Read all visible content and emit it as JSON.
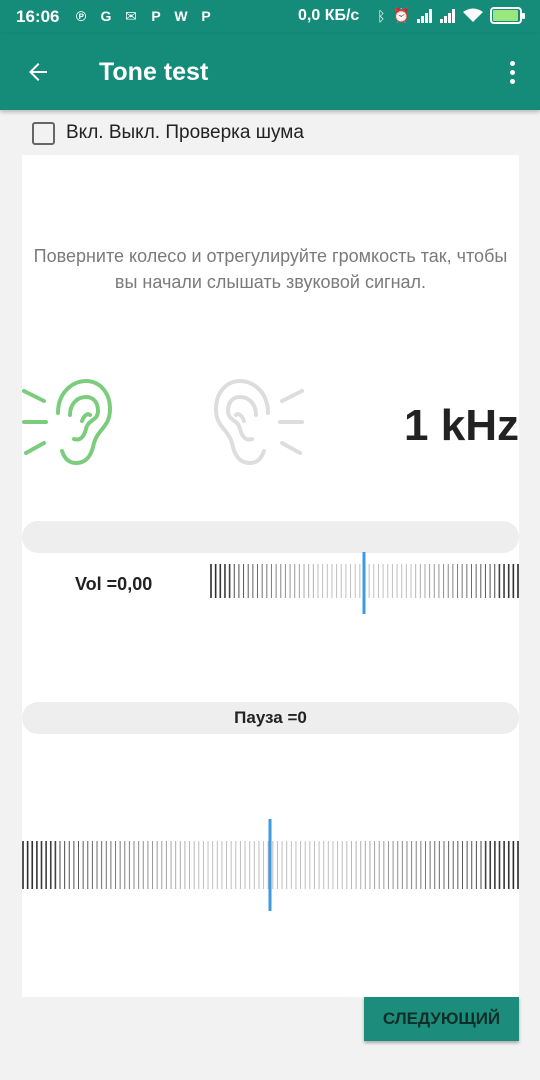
{
  "status_bar": {
    "time": "16:06",
    "network_speed": "0,0 КБ/с",
    "notification_icons": [
      "pinterest-icon",
      "c-app-icon",
      "mail-icon",
      "p-app-icon",
      "ww-app-icon",
      "p-app-icon"
    ],
    "system_icons": [
      "bluetooth-icon",
      "alarm-off-icon",
      "signal-icon",
      "signal-icon",
      "wifi-icon",
      "battery-charging-icon"
    ]
  },
  "app_bar": {
    "title": "Tone test",
    "back_icon": "arrow-back-icon",
    "menu_icon": "more-vert-icon",
    "color": "#158b79"
  },
  "noise_check": {
    "label": "Вкл. Выкл. Проверка шума",
    "checked": false
  },
  "instructions": "Поверните колесо и отрегулируйте громкость так, чтобы вы начали слышать звуковой сигнал.",
  "ears": {
    "left": {
      "icon": "ear-left-icon",
      "active": true,
      "color": "#7ccc7e"
    },
    "right": {
      "icon": "ear-right-icon",
      "active": false,
      "color": "#dddddd"
    }
  },
  "frequency": "1 kHz",
  "volume": {
    "label": "Vol =0,00",
    "indicator_color": "#3d9be6"
  },
  "pause": {
    "label": "Пауза =0"
  },
  "next_button": {
    "label": "СЛЕДУЮЩИЙ",
    "color": "#1c8c7c"
  }
}
